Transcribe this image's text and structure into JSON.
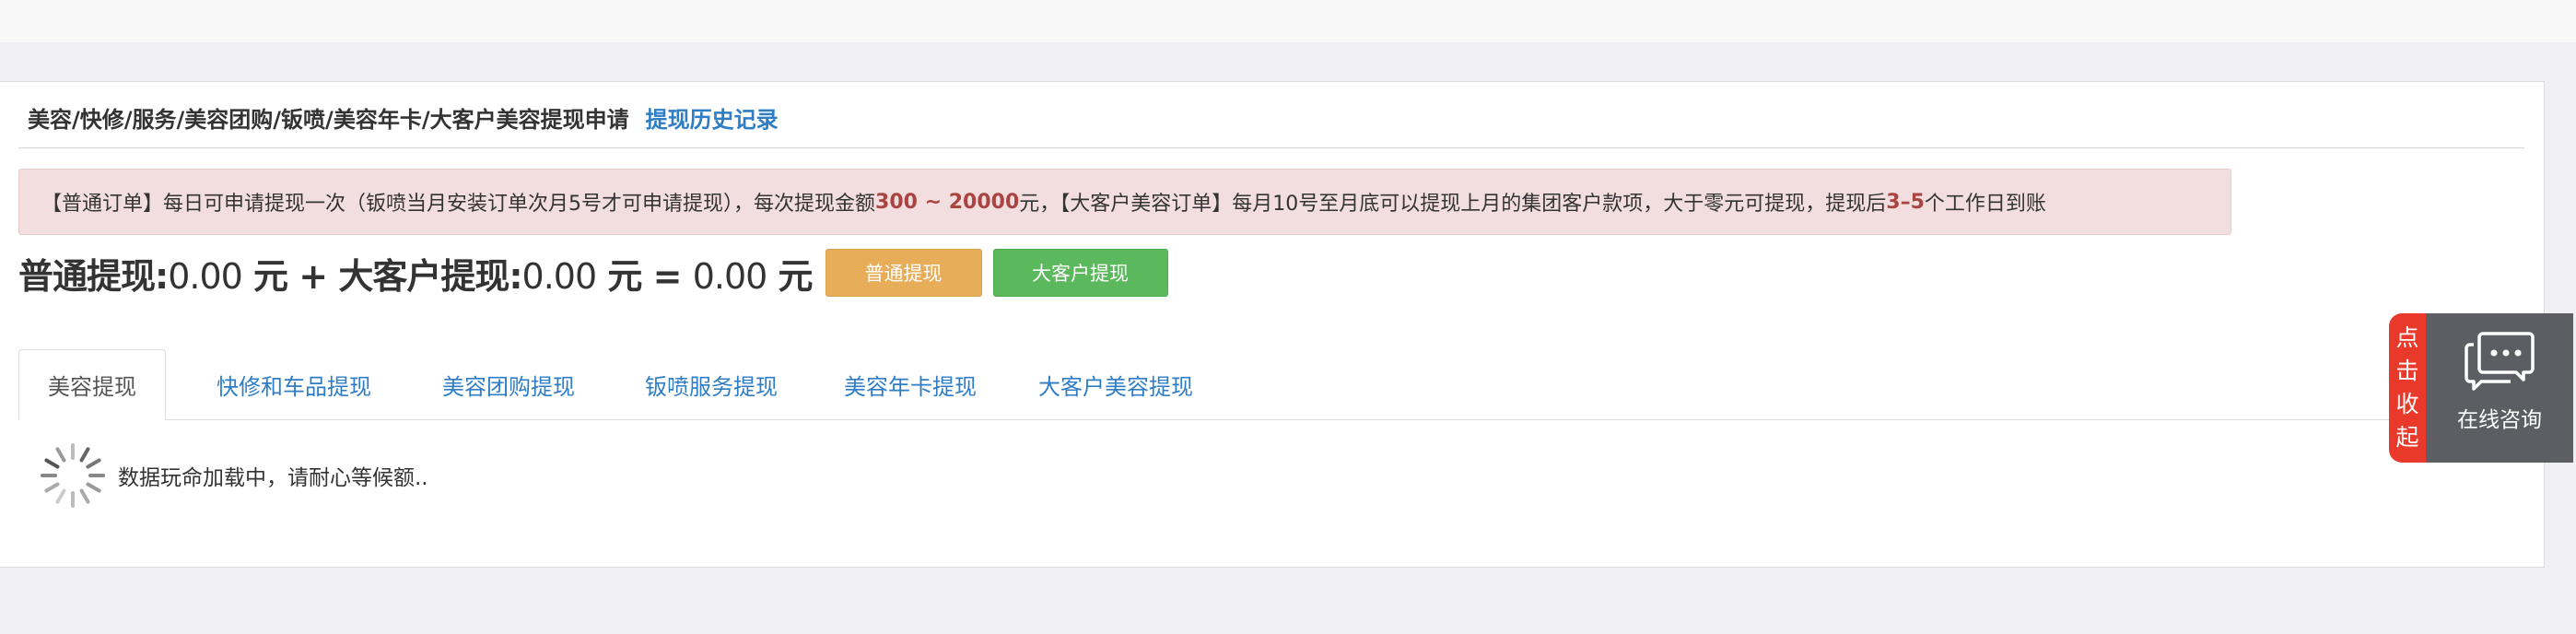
{
  "header": {
    "breadcrumb": "美容/快修/服务/美容团购/钣喷/美容年卡/大客户美容提现申请",
    "history_link": "提现历史记录"
  },
  "notice": {
    "part1": "【普通订单】每日可申请提现一次（钣喷当月安装订单次月5号才可申请提现），每次提现金额",
    "amount_min": "300",
    "tilde": " ~ ",
    "amount_max": "20000",
    "part2": "元，【大客户美容订单】每月10号至月底可以提现上月的集团客户款项，大于零元可提现，提现后",
    "days": "3–5",
    "part3": "个工作日到账"
  },
  "totals": {
    "normal_label": "普通提现:",
    "normal_value": "0.00",
    "unit1": " 元 + ",
    "big_label": "大客户提现:",
    "big_value": "0.00",
    "unit2": " 元 = ",
    "total_value": "0.00",
    "unit3": " 元"
  },
  "buttons": {
    "normal": "普通提现",
    "big_client": "大客户提现"
  },
  "tabs": [
    {
      "label": "美容提现"
    },
    {
      "label": "快修和车品提现"
    },
    {
      "label": "美容团购提现"
    },
    {
      "label": "钣喷服务提现"
    },
    {
      "label": "美容年卡提现"
    },
    {
      "label": "大客户美容提现"
    }
  ],
  "active_tab": "美容提现",
  "loading_text": "数据玩命加载中，请耐心等候额..",
  "chat": {
    "collapse_chars": [
      "点",
      "击",
      "收",
      "起"
    ],
    "label": "在线咨询",
    "icon": "chat-bubble-icon"
  },
  "colors": {
    "link": "#2f7dc5",
    "notice_bg": "#f2dede",
    "notice_highlight": "#a94442",
    "btn_normal": "#e8ad58",
    "btn_big": "#5cb85c",
    "collapse_tab": "#e8392a",
    "chat_bg": "#5c5e63"
  }
}
